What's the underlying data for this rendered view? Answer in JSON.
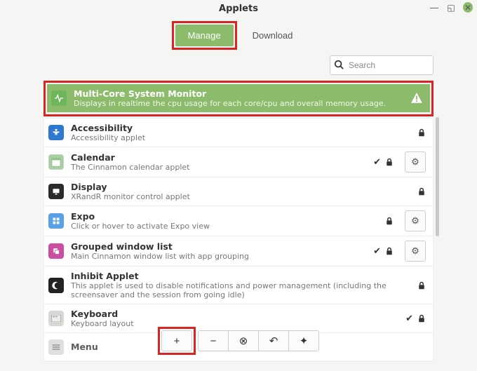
{
  "window": {
    "title": "Applets"
  },
  "tabs": {
    "manage": "Manage",
    "download": "Download"
  },
  "search": {
    "placeholder": "Search"
  },
  "items": [
    {
      "title": "Multi-Core System Monitor",
      "subtitle": "Displays in realtime the cpu usage for each core/cpu and overall memory usage.",
      "icon": "ic-green",
      "iconName": "system-monitor-icon",
      "selected": true,
      "warn": true,
      "check": false,
      "lock": false,
      "settings": false
    },
    {
      "title": "Accessibility",
      "subtitle": "Accessibility applet",
      "icon": "ic-blue",
      "iconName": "accessibility-icon",
      "check": false,
      "lock": true,
      "settings": false
    },
    {
      "title": "Calendar",
      "subtitle": "The Cinnamon calendar applet",
      "icon": "ic-lgreen",
      "iconName": "calendar-icon",
      "check": true,
      "lock": true,
      "settings": true
    },
    {
      "title": "Display",
      "subtitle": "XRandR monitor control applet",
      "icon": "ic-black",
      "iconName": "display-icon",
      "check": false,
      "lock": true,
      "settings": false
    },
    {
      "title": "Expo",
      "subtitle": "Click or hover to activate Expo view",
      "icon": "ic-sky",
      "iconName": "expo-icon",
      "check": false,
      "lock": true,
      "settings": true
    },
    {
      "title": "Grouped window list",
      "subtitle": "Main Cinnamon window list with app grouping",
      "icon": "ic-pink",
      "iconName": "grouped-window-list-icon",
      "check": true,
      "lock": true,
      "settings": true
    },
    {
      "title": "Inhibit Applet",
      "subtitle": "This applet is used to disable notifications and power management (including the screensaver and the session from going idle)",
      "icon": "ic-dark",
      "iconName": "inhibit-icon",
      "check": false,
      "lock": true,
      "settings": false
    },
    {
      "title": "Keyboard",
      "subtitle": "Keyboard layout",
      "icon": "ic-grey",
      "iconName": "keyboard-icon",
      "check": true,
      "lock": true,
      "settings": false
    },
    {
      "title": "Menu",
      "subtitle": "",
      "icon": "ic-grey",
      "iconName": "menu-icon",
      "check": false,
      "lock": false,
      "settings": false
    }
  ],
  "actions": {
    "add": "+",
    "remove": "−",
    "cancel": "⊗",
    "reset": "↶",
    "star": "✦"
  }
}
